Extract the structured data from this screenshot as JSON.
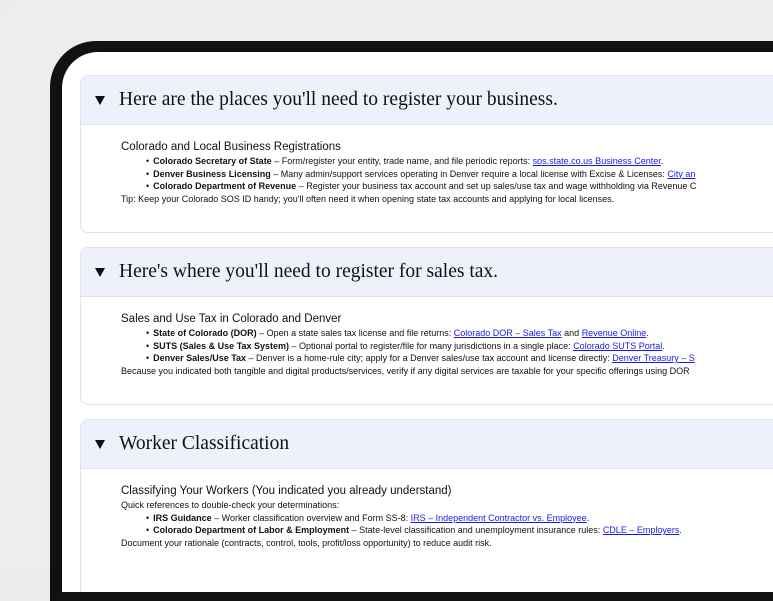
{
  "sections": [
    {
      "title": "Here are the places you'll need to register your business.",
      "subtitle": "Colorado and Local Business Registrations",
      "items": [
        {
          "bold": "Colorado Secretary of State",
          "text": " – Form/register your entity, trade name, and file periodic reports: ",
          "links": [
            "sos.state.co.us Business Center"
          ],
          "tail": "."
        },
        {
          "bold": "Denver Business Licensing",
          "text": " – Many admin/support services operating in Denver require a local license with Excise & Licenses: ",
          "links": [
            "City an"
          ],
          "tail": ""
        },
        {
          "bold": "Colorado Department of Revenue",
          "text": " – Register your business tax account and set up sales/use tax and wage withholding via Revenue C",
          "links": [],
          "tail": ""
        }
      ],
      "note": "Tip: Keep your Colorado SOS ID handy; you'll often need it when opening state tax accounts and applying for local licenses."
    },
    {
      "title": "Here's where you'll need to register for sales tax.",
      "subtitle": "Sales and Use Tax in Colorado and Denver",
      "items": [
        {
          "bold": "State of Colorado (DOR)",
          "text": " – Open a state sales tax license and file returns: ",
          "links": [
            "Colorado DOR – Sales Tax",
            "Revenue Online"
          ],
          "tail": "."
        },
        {
          "bold": "SUTS (Sales & Use Tax System)",
          "text": " – Optional portal to register/file for many jurisdictions in a single place: ",
          "links": [
            "Colorado SUTS Portal"
          ],
          "tail": "."
        },
        {
          "bold": "Denver Sales/Use Tax",
          "text": " – Denver is a home-rule city; apply for a Denver sales/use tax account and license directly: ",
          "links": [
            "Denver Treasury – S"
          ],
          "tail": ""
        }
      ],
      "note": "Because you indicated both tangible and digital products/services, verify if any digital services are taxable for your specific offerings using DOR"
    },
    {
      "title": "Worker Classification",
      "subtitle": "Classifying Your Workers (You indicated you already understand)",
      "intro": "Quick references to double-check your determinations:",
      "items": [
        {
          "bold": "IRS Guidance",
          "text": " – Worker classification overview and Form SS-8: ",
          "links": [
            "IRS – Independent Contractor vs. Employee"
          ],
          "tail": "."
        },
        {
          "bold": "Colorado Department of Labor & Employment",
          "text": " – State-level classification and unemployment insurance rules: ",
          "links": [
            "CDLE – Employers"
          ],
          "tail": "."
        }
      ],
      "note": "Document your rationale (contracts, control, tools, profit/loss opportunity) to reduce audit risk."
    }
  ],
  "link_joiner": " and ",
  "bullet": "•"
}
